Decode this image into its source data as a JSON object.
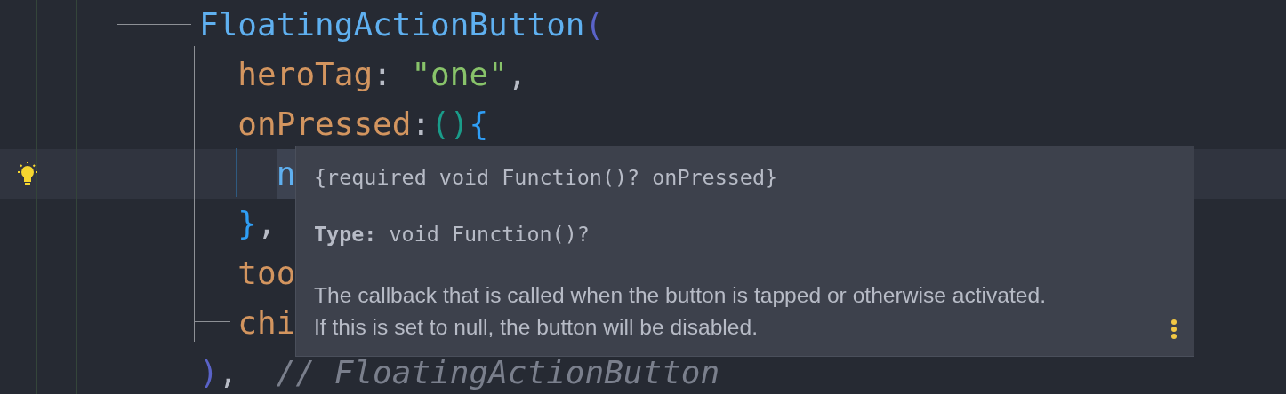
{
  "editor": {
    "lines": [
      {
        "current": false,
        "intention": false,
        "tokens": [
          {
            "text": "FloatingActionButton",
            "kind": "class"
          },
          {
            "text": "(",
            "kind": "bracket1"
          }
        ]
      },
      {
        "current": false,
        "intention": false,
        "tokens": [
          {
            "text": "  heroTag",
            "kind": "param"
          },
          {
            "text": ": ",
            "kind": "punct"
          },
          {
            "text": "\"one\"",
            "kind": "string"
          },
          {
            "text": ",",
            "kind": "punct"
          }
        ]
      },
      {
        "current": false,
        "intention": false,
        "tokens": [
          {
            "text": "  onPressed",
            "kind": "param"
          },
          {
            "text": ":",
            "kind": "punct"
          },
          {
            "text": "()",
            "kind": "bracket2"
          },
          {
            "text": "{",
            "kind": "bracket3"
          }
        ]
      },
      {
        "current": true,
        "intention": true,
        "tokens": [
          {
            "text": "    n",
            "kind": "class",
            "highlighted": true
          }
        ]
      },
      {
        "current": false,
        "intention": false,
        "tokens": [
          {
            "text": "  }",
            "kind": "bracket3"
          },
          {
            "text": ",",
            "kind": "punct"
          }
        ]
      },
      {
        "current": false,
        "intention": false,
        "tokens": [
          {
            "text": "  too",
            "kind": "param"
          }
        ]
      },
      {
        "current": false,
        "intention": false,
        "tokens": [
          {
            "text": "  chi",
            "kind": "param"
          }
        ]
      },
      {
        "current": false,
        "intention": false,
        "tokens": [
          {
            "text": ")",
            "kind": "bracket1"
          },
          {
            "text": ",  ",
            "kind": "punct"
          },
          {
            "text": "// FloatingActionButton",
            "kind": "comment"
          }
        ]
      }
    ]
  },
  "doc_popup": {
    "signature": "{required void Function()? onPressed}",
    "type_label": "Type:",
    "type_value": "void Function()?",
    "description_lines": [
      "The callback that is called when the button is tapped or otherwise activated.",
      "If this is set to null, the button will be disabled."
    ]
  }
}
